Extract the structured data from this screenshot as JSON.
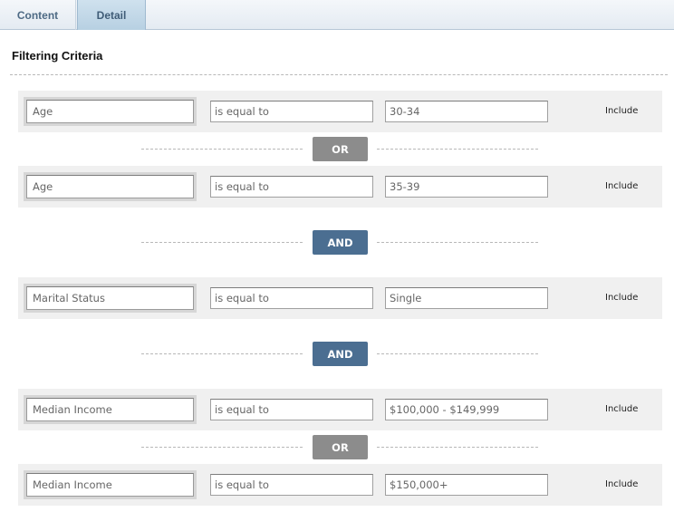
{
  "tabs": [
    {
      "label": "Content",
      "active": false
    },
    {
      "label": "Detail",
      "active": true
    }
  ],
  "section_title": "Filtering Criteria",
  "rows": [
    {
      "field": "Age",
      "operator": "is equal to",
      "value": "30-34",
      "include": "Include"
    },
    {
      "field": "Age",
      "operator": "is equal to",
      "value": "35-39",
      "include": "Include"
    },
    {
      "field": "Marital Status",
      "operator": "is equal to",
      "value": "Single",
      "include": "Include"
    },
    {
      "field": "Median Income",
      "operator": "is equal to",
      "value": "$100,000 - $149,999",
      "include": "Include"
    },
    {
      "field": "Median Income",
      "operator": "is equal to",
      "value": "$150,000+",
      "include": "Include"
    }
  ],
  "connectors": [
    {
      "label": "OR",
      "color": "#8c8c8c"
    },
    {
      "label": "AND",
      "color": "#4b6e91"
    },
    {
      "label": "AND",
      "color": "#4b6e91"
    },
    {
      "label": "OR",
      "color": "#8c8c8c"
    }
  ]
}
